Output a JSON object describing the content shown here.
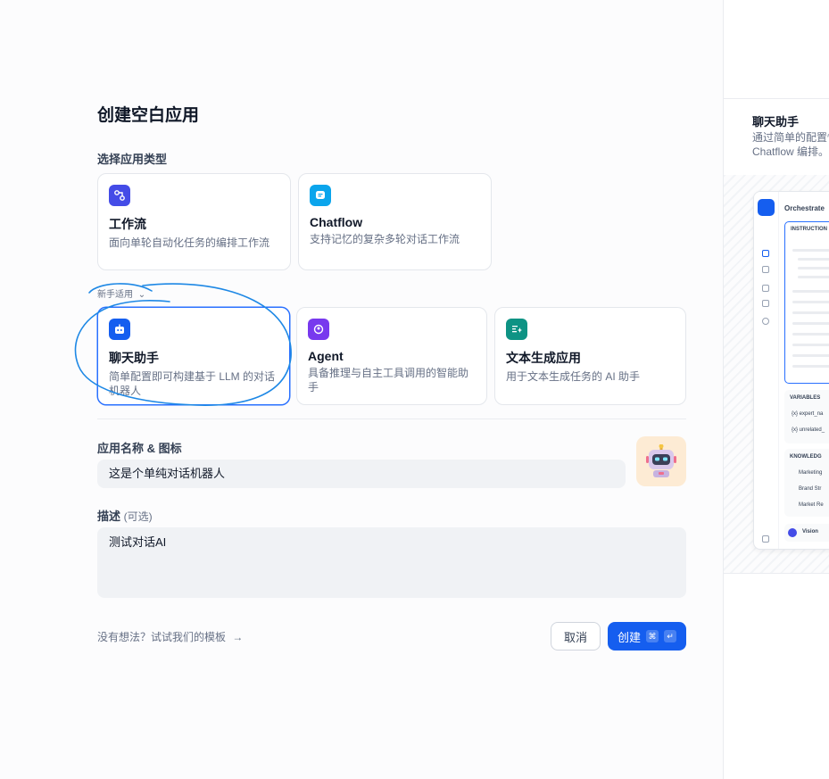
{
  "page": {
    "title": "创建空白应用"
  },
  "app_type": {
    "label": "选择应用类型",
    "beginner_label": "新手适用",
    "cards": [
      {
        "id": "workflow",
        "title": "工作流",
        "desc": "面向单轮自动化任务的编排工作流",
        "icon": "workflow-icon",
        "color": "#444ce7"
      },
      {
        "id": "chatflow",
        "title": "Chatflow",
        "desc": "支持记忆的复杂多轮对话工作流",
        "icon": "chatflow-icon",
        "color": "#0ba5ec"
      },
      {
        "id": "chatbot",
        "title": "聊天助手",
        "desc": "简单配置即可构建基于 LLM 的对话机器人",
        "icon": "chatbot-icon",
        "color": "#155eef",
        "selected": true
      },
      {
        "id": "agent",
        "title": "Agent",
        "desc": "具备推理与自主工具调用的智能助手",
        "icon": "agent-icon",
        "color": "#7839ee"
      },
      {
        "id": "completion",
        "title": "文本生成应用",
        "desc": "用于文本生成任务的 AI 助手",
        "icon": "text-generation-icon",
        "color": "#0e9384"
      }
    ]
  },
  "form": {
    "name_label": "应用名称 & 图标",
    "name_value": "这是个单纯对话机器人",
    "desc_label": "描述",
    "desc_optional": "(可选)",
    "desc_value": "测试对话AI"
  },
  "footer": {
    "template_link": "没有想法？试试我们的模板",
    "cancel": "取消",
    "create": "创建",
    "kbd_cmd": "⌘",
    "kbd_enter": "↵"
  },
  "preview": {
    "title": "聊天助手",
    "desc_line1": "通过简单的配置快",
    "desc_line2": "Chatflow 编排。",
    "header": "Orchestrate",
    "instruction": "INSTRUCTION",
    "variables": "VARIABLES",
    "var1": "{x} expert_na",
    "var2": "{x} unrelated_",
    "knowledge": "KNOWLEDG",
    "k1": "Marketing",
    "k2": "Brand Str",
    "k3": "Market Re",
    "vision": "Vision"
  },
  "colors": {
    "accent": "#155eef",
    "annotation": "#1e88e5"
  }
}
